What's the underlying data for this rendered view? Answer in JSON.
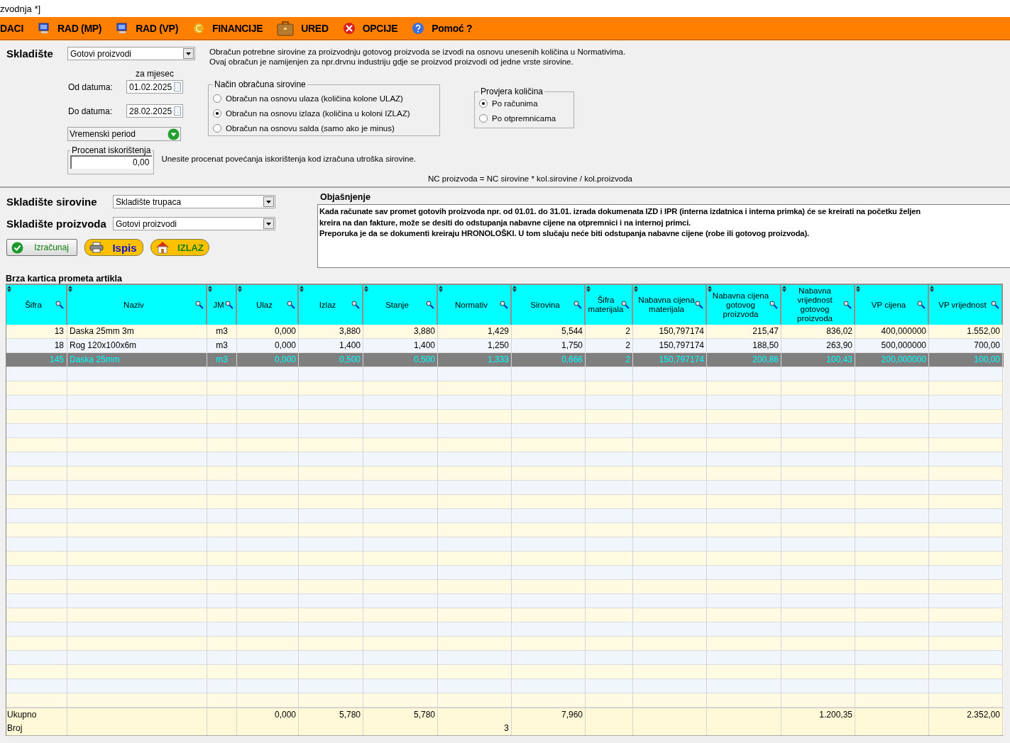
{
  "window": {
    "title": "zvodnja *]"
  },
  "menu": [
    {
      "label": "DACI"
    },
    {
      "label": "RAD (MP)"
    },
    {
      "label": "RAD (VP)"
    },
    {
      "label": "FINANCIJE"
    },
    {
      "label": "URED"
    },
    {
      "label": "OPCIJE"
    },
    {
      "label": "Pomoć ?"
    }
  ],
  "form": {
    "warehouse": {
      "label": "Skladište",
      "value": "Gotovi proizvodi"
    },
    "description": [
      "Obračun potrebne sirovine za proizvodnju gotovog proizvoda se izvodi na osnovu unesenih količina u Normativima.",
      "Ovaj obračun je namijenjen za npr.drvnu industriju gdje se proizvod proizvodi od jedne vrste sirovine."
    ],
    "month_label": "za mjesec",
    "date_from": {
      "label": "Od datuma:",
      "value": "01.02.2025"
    },
    "date_to": {
      "label": "Do datuma:",
      "value": "28.02.2025"
    },
    "period": {
      "value": "Vremenski period"
    },
    "percent": {
      "legend": "Procenat iskorištenja",
      "value": "0,00"
    },
    "percent_hint": "Unesite procenat povećanja iskorištenja kod izračuna utroška sirovine.",
    "method": {
      "legend": "Način obračuna sirovine",
      "options": [
        {
          "label": "Obračun na osnovu ulaza (količina kolone ULAZ)",
          "selected": false
        },
        {
          "label": "Obračun na osnovu izlaza (količina u koloni IZLAZ)",
          "selected": true
        },
        {
          "label": "Obračun na osnovu salda (samo ako je minus)",
          "selected": false
        }
      ]
    },
    "check": {
      "legend": "Provjera količina",
      "options": [
        {
          "label": "Po računima",
          "selected": true
        },
        {
          "label": "Po otpremnicama",
          "selected": false
        }
      ]
    },
    "formula": "NC proizvoda = NC sirovine * kol.sirovine / kol.proizvoda"
  },
  "warehouses": [
    {
      "label": "Skladište sirovine",
      "value": "Skladište trupaca"
    },
    {
      "label": "Skladište proizvoda",
      "value": "Gotovi proizvodi"
    }
  ],
  "buttons": [
    {
      "label": "Izračunaj",
      "kind": "calc"
    },
    {
      "label": "Ispis",
      "kind": "print"
    },
    {
      "label": "IZLAZ",
      "kind": "exit"
    }
  ],
  "explanation": {
    "title": "Objašnjenje",
    "lines": [
      "Kada računate sav promet gotovih proizvoda npr. od 01.01. do 31.01. izrada dokumenata IZD i IPR (interna izdatnica i interna primka) će se kreirati na početku željen",
      "kreira na dan fakture, može se desiti do odstupanja nabavne cijene na otpremnici i na internoj primci.",
      "Preporuka je da se dokumenti kreiraju HRONOLOŠKI. U tom slučaju neće biti odstupanja nabavne cijene (robe ili gotovog proizvoda)."
    ]
  },
  "table": {
    "title": "Brza kartica prometa artikla",
    "columns": [
      "Šifra",
      "Naziv",
      "JM",
      "Ulaz",
      "Izlaz",
      "Stanje",
      "Normativ",
      "Sirovina",
      "Šifra materijala",
      "Nabavna cijena materijala",
      "Nabavna cijena gotovog proizvoda",
      "Nabavna vrijednost gotovog proizvoda",
      "VP cijena",
      "VP vrijednost"
    ],
    "rows": [
      {
        "selected": false,
        "cells": [
          "13",
          "Daska 25mm 3m",
          "m3",
          "0,000",
          "3,880",
          "3,880",
          "1,429",
          "5,544",
          "2",
          "150,797174",
          "215,47",
          "836,02",
          "400,000000",
          "1.552,00"
        ]
      },
      {
        "selected": false,
        "cells": [
          "18",
          "Rog 120x100x6m",
          "m3",
          "0,000",
          "1,400",
          "1,400",
          "1,250",
          "1,750",
          "2",
          "150,797174",
          "188,50",
          "263,90",
          "500,000000",
          "700,00"
        ]
      },
      {
        "selected": true,
        "cells": [
          "145",
          "Daska 25mm",
          "m3",
          "0,000",
          "0,500",
          "0,500",
          "1,333",
          "0,666",
          "2",
          "150,797174",
          "200,86",
          "100,43",
          "200,000000",
          "100,00"
        ]
      }
    ],
    "totals": [
      {
        "label": "Ukupno",
        "cells": [
          null,
          null,
          null,
          "0,000",
          "5,780",
          "5,780",
          null,
          "7,960",
          null,
          null,
          null,
          "1.200,35",
          null,
          "2.352,00"
        ]
      },
      {
        "label": "Broj",
        "cells": [
          null,
          null,
          null,
          null,
          null,
          null,
          "3",
          null,
          null,
          null,
          null,
          null,
          null,
          null
        ]
      }
    ]
  }
}
